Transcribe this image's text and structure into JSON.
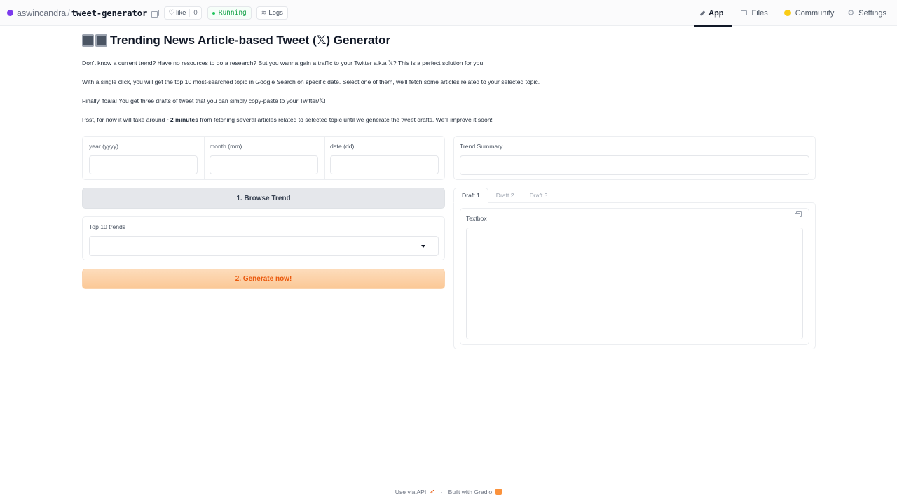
{
  "topbar": {
    "owner": "aswincandra",
    "separator": "/",
    "repo": "tweet-generator",
    "like_label": "like",
    "like_count": "0",
    "status": "Running",
    "logs_label": "Logs",
    "nav": {
      "app": "App",
      "files": "Files",
      "community": "Community",
      "settings": "Settings"
    }
  },
  "header": {
    "title": "Trending News Article-based Tweet (𝕏) Generator",
    "p1": "Don't know a current trend? Have no resources to do a research? But you wanna gain a traffic to your Twitter a.k.a 𝕏? This is a perfect solution for you!",
    "p2": "With a single click, you will get the top 10 most-searched topic in Google Search on specific date. Select one of them, we'll fetch some articles related to your selected topic.",
    "p3": "Finally, foala! You get three drafts of tweet that you can simply copy-paste to your Twitter/𝕏!",
    "p4_pre": "Psst, for now it will take around ",
    "p4_bold": "~2 minutes",
    "p4_post": " from fetching several articles related to selected topic until we generate the tweet drafts. We'll improve it soon!"
  },
  "form": {
    "year_label": "year (yyyy)",
    "month_label": "month (mm)",
    "date_label": "date (dd)",
    "year_value": "",
    "month_value": "",
    "date_value": "",
    "browse_button": "1. Browse Trend",
    "trends_label": "Top 10 trends",
    "trends_selected": "",
    "generate_button": "2. Generate now!"
  },
  "output": {
    "summary_label": "Trend Summary",
    "summary_value": "",
    "tabs": [
      "Draft 1",
      "Draft 2",
      "Draft 3"
    ],
    "textbox_label": "Textbox",
    "textbox_value": ""
  },
  "footer": {
    "api": "Use via API",
    "separator": "·",
    "built": "Built with Gradio"
  }
}
